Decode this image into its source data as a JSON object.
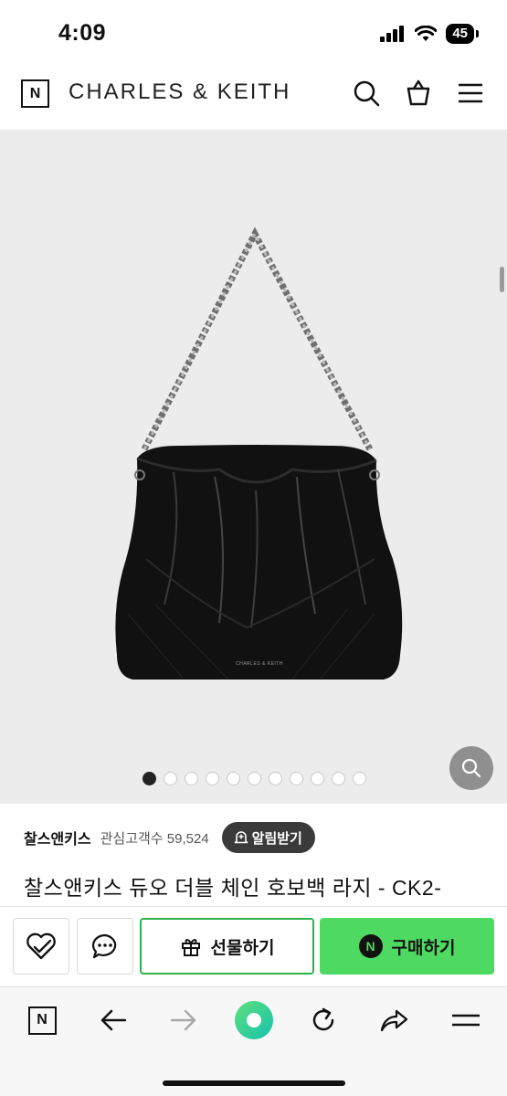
{
  "status": {
    "time": "4:09",
    "battery": "45"
  },
  "header": {
    "logo": "N",
    "brand": "CHARLES & KEITH"
  },
  "product": {
    "image_alt": "black patent chain hobo bag",
    "bag_tag": "CHARLES & KEITH",
    "carousel": {
      "count": 11,
      "active_index": 0
    }
  },
  "info": {
    "store_name": "찰스앤키스",
    "followers": "관심고객수 59,524",
    "alert_label": "알림받기",
    "title": "찰스앤키스 듀오 더블 체인 호보백 라지 - CK2-"
  },
  "actions": {
    "gift_label": "선물하기",
    "buy_label": "구매하기",
    "buy_icon": "N"
  },
  "browser": {
    "home_icon": "N"
  },
  "colors": {
    "accent_green": "#4dd962",
    "gift_border": "#2bb34a",
    "image_bg": "#ececec"
  }
}
